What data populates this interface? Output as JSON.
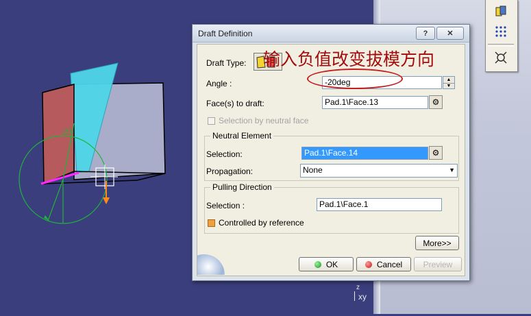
{
  "dialog": {
    "title": "Draft Definition",
    "help_label": "?",
    "close_label": "✕",
    "draft_type_label": "Draft Type:",
    "angle_label": "Angle :",
    "angle_value": "-20deg",
    "faces_label": "Face(s) to draft:",
    "faces_value": "Pad.1\\Face.13",
    "selection_by_neutral_label": "Selection by neutral face",
    "neutral_element": {
      "title": "Neutral Element",
      "selection_label": "Selection:",
      "selection_value": "Pad.1\\Face.14",
      "propagation_label": "Propagation:",
      "propagation_value": "None"
    },
    "pulling_direction": {
      "title": "Pulling Direction",
      "selection_label": "Selection :",
      "selection_value": "Pad.1\\Face.1",
      "controlled_label": "Controlled by reference"
    },
    "more_label": "More>>",
    "ok_label": "OK",
    "cancel_label": "Cancel",
    "preview_label": "Preview"
  },
  "annotation": {
    "text": "输入负值改变拔模方向",
    "color": "#a40c0c"
  },
  "viewport": {
    "angle_text": "20",
    "axis_label": "xy",
    "axis_z": "z"
  },
  "colors": {
    "background": "#3b3e7c",
    "face_red": "#b65a5e",
    "face_cyan": "#4fd6e8",
    "selection_blue": "#3399ff"
  }
}
